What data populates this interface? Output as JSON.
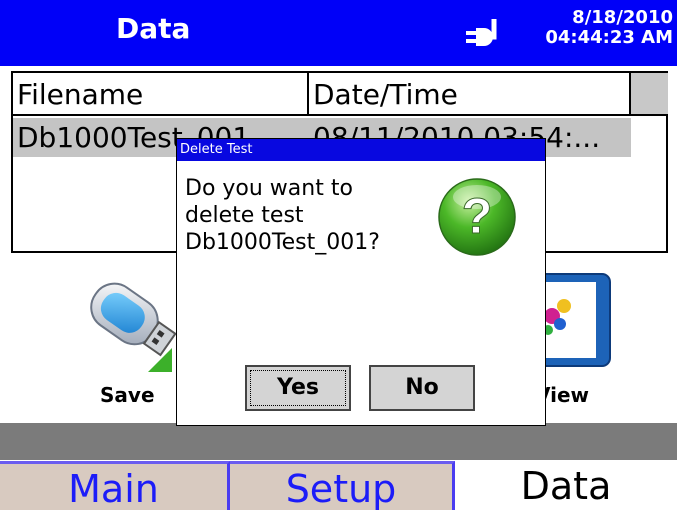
{
  "titlebar": {
    "title": "Data",
    "date": "8/18/2010",
    "time": "04:44:23 AM",
    "icon": "power-plug-icon"
  },
  "table": {
    "headers": [
      "Filename",
      "Date/Time"
    ],
    "rows": [
      {
        "filename": "Db1000Test_001",
        "datetime": "08/11/2010 03:54:..."
      }
    ]
  },
  "icons": {
    "save_label": "Save",
    "view_label": "View"
  },
  "tabs": [
    {
      "label": "Main"
    },
    {
      "label": "Setup"
    },
    {
      "label": "Data",
      "active": true
    }
  ],
  "dialog": {
    "title": "Delete Test",
    "message": "Do you want to delete test Db1000Test_001?",
    "icon": "question-icon",
    "yes_label": "Yes",
    "no_label": "No"
  },
  "colors": {
    "titlebar": "#0000f8",
    "tab_text": "#1c1cf8",
    "tab_bg": "#d8cac0",
    "dialog_title": "#0808e0",
    "selected_row": "#c4c4c4"
  }
}
